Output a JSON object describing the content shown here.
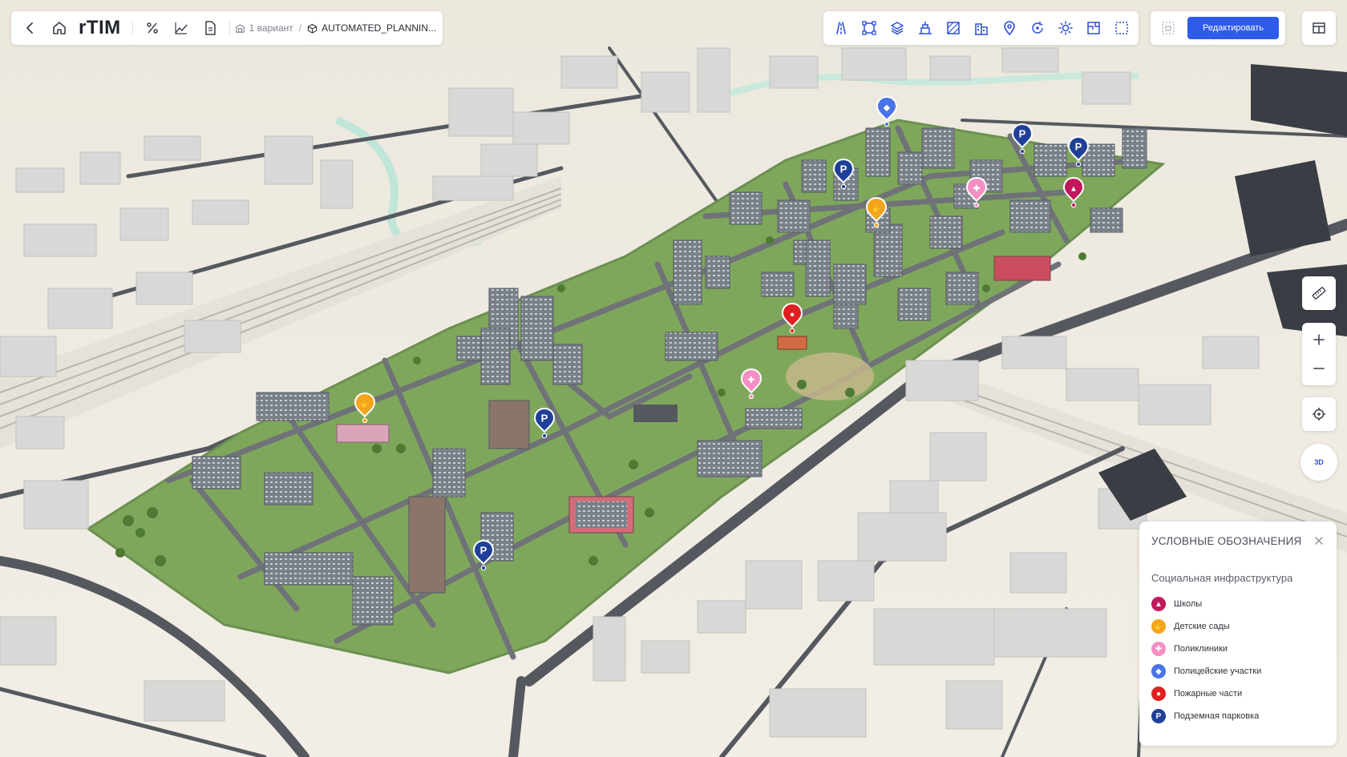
{
  "app": {
    "logo": "rTIM"
  },
  "breadcrumb": {
    "variant": "1 вариант",
    "separator": "/",
    "project": "AUTOMATED_PLANNIN..."
  },
  "toolbar": {
    "left_icons": [
      "back-icon",
      "home-icon",
      "percent-icon",
      "chart-icon",
      "document-icon"
    ],
    "tools": [
      "roads-icon",
      "polygon-icon",
      "layers-icon",
      "terrain-icon",
      "texture-icon",
      "buildings-icon",
      "poi-icon",
      "rotate-icon",
      "sun-icon",
      "floorplan-icon",
      "frame-icon"
    ],
    "edit_label": "Редактировать"
  },
  "colors": {
    "accent": "#2f5bea",
    "school": "#c2185b",
    "kindergarten": "#f4a51c",
    "clinic": "#f48fc4",
    "police": "#4a73e8",
    "fire": "#e02020",
    "parking": "#1f3f99"
  },
  "legend": {
    "title": "УСЛОВНЫЕ ОБОЗНАЧЕНИЯ",
    "subtitle": "Социальная инфраструктура",
    "items": [
      {
        "label": "Школы",
        "icon": "school-icon",
        "color": "#c2185b"
      },
      {
        "label": "Детские сады",
        "icon": "kindergarten-icon",
        "color": "#f4a51c"
      },
      {
        "label": "Поликлиники",
        "icon": "clinic-icon",
        "color": "#f48fc4"
      },
      {
        "label": "Полицейские участки",
        "icon": "police-icon",
        "color": "#4a73e8"
      },
      {
        "label": "Пожарные части",
        "icon": "fire-icon",
        "color": "#e02020"
      },
      {
        "label": "Подземная парковка",
        "icon": "parking-icon",
        "color": "#1f3f99"
      }
    ]
  },
  "map_controls": {
    "compass_label": "3D"
  },
  "markers": [
    {
      "type": "police",
      "glyph": ""
    },
    {
      "type": "parking",
      "glyph": "P"
    },
    {
      "type": "parking",
      "glyph": "P"
    },
    {
      "type": "parking",
      "glyph": "P"
    },
    {
      "type": "clinic",
      "glyph": ""
    },
    {
      "type": "school",
      "glyph": ""
    },
    {
      "type": "kindergarten",
      "glyph": ""
    },
    {
      "type": "fire",
      "glyph": ""
    },
    {
      "type": "clinic",
      "glyph": ""
    },
    {
      "type": "kindergarten",
      "glyph": ""
    },
    {
      "type": "parking",
      "glyph": "P"
    },
    {
      "type": "parking",
      "glyph": "P"
    }
  ]
}
